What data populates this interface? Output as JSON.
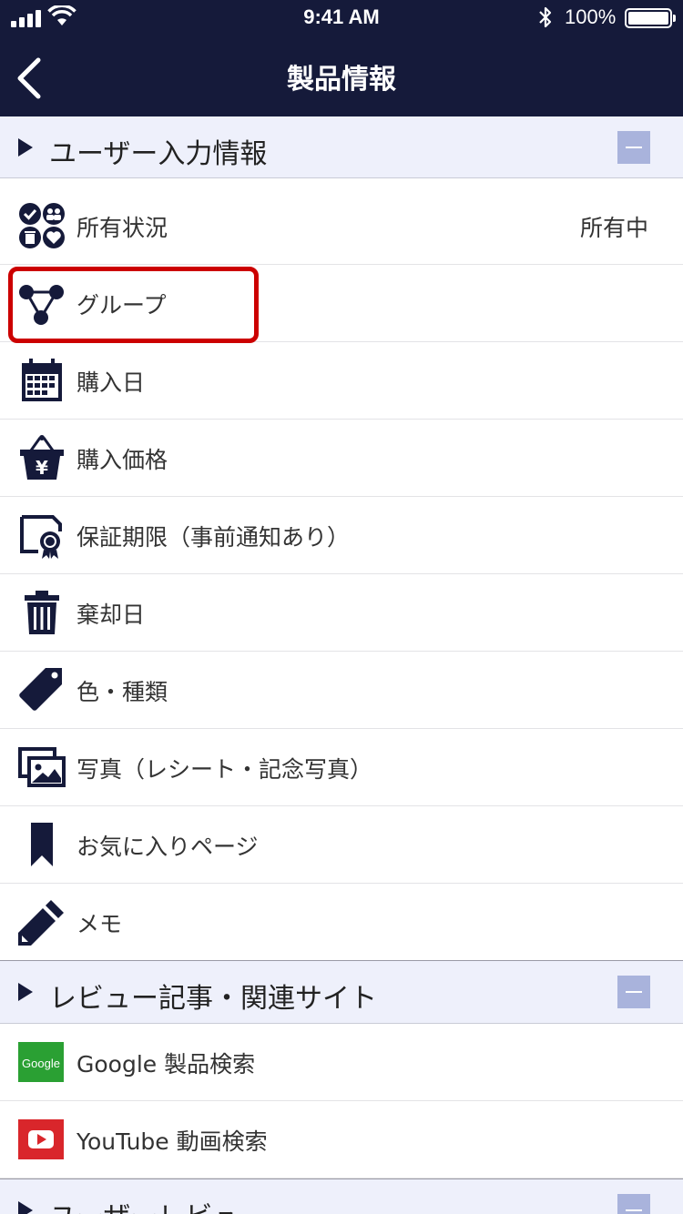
{
  "status_bar": {
    "time": "9:41 AM",
    "battery": "100%"
  },
  "nav": {
    "title": "製品情報",
    "back_icon": "chevron-left-icon"
  },
  "sections": {
    "user_input": {
      "label": "ユーザー入力情報"
    },
    "reviews": {
      "label": "レビュー記事・関連サイト"
    },
    "user_reviews": {
      "label": "ユーザーレビュ"
    }
  },
  "rows": {
    "ownership": {
      "label": "所有状況",
      "value": "所有中",
      "icon": "ownership-status-icon"
    },
    "group": {
      "label": "グループ",
      "icon": "group-network-icon"
    },
    "purchase_date": {
      "label": "購入日",
      "icon": "calendar-icon"
    },
    "purchase_price": {
      "label": "購入価格",
      "icon": "yen-basket-icon"
    },
    "warranty": {
      "label": "保証期限（事前通知あり）",
      "icon": "certificate-icon"
    },
    "disposal_date": {
      "label": "棄却日",
      "icon": "trash-icon"
    },
    "color_type": {
      "label": "色・種類",
      "icon": "tag-icon"
    },
    "photos": {
      "label": "写真（レシート・記念写真）",
      "icon": "photos-icon"
    },
    "favorite_pages": {
      "label": "お気に入りページ",
      "icon": "bookmark-icon"
    },
    "memo": {
      "label": "メモ",
      "icon": "pencil-icon"
    },
    "google": {
      "label": "Google 製品検索",
      "logo_text": "Google",
      "icon": "google-logo-icon"
    },
    "youtube": {
      "label": "YouTube 動画検索",
      "icon": "youtube-logo-icon"
    }
  },
  "colors": {
    "navy": "#151a3a",
    "section_bg": "#eef0fb",
    "collapse": "#a9b3dc",
    "highlight": "#cc0000",
    "google_green": "#2aa033",
    "youtube_red": "#d9262b"
  }
}
